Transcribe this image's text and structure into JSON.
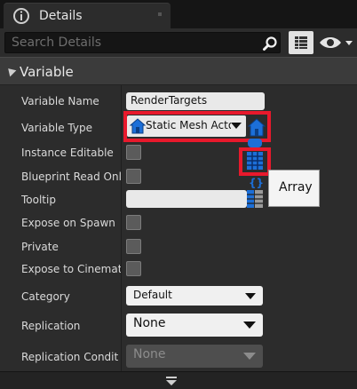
{
  "tab": {
    "title": "Details",
    "icon": "info-icon"
  },
  "search": {
    "placeholder": "Search Details"
  },
  "toolbar": {
    "view_options_icon": "grid-icon",
    "visibility_icon": "eye-icon"
  },
  "category": {
    "label": "Variable",
    "expanded": true
  },
  "properties": {
    "variable_name": {
      "label": "Variable Name",
      "value": "RenderTargets"
    },
    "variable_type": {
      "label": "Variable Type",
      "value": "Static Mesh Acto",
      "icon": "actor-icon"
    },
    "instance_editable": {
      "label": "Instance Editable"
    },
    "blueprint_read_only": {
      "label": "Blueprint Read Only"
    },
    "tooltip": {
      "label": "Tooltip",
      "value": ""
    },
    "expose_on_spawn": {
      "label": "Expose on Spawn"
    },
    "private": {
      "label": "Private"
    },
    "expose_to_cinematics": {
      "label": "Expose to Cinemati"
    },
    "category": {
      "label": "Category",
      "value": "Default"
    },
    "replication": {
      "label": "Replication",
      "value": "None"
    },
    "replication_condition": {
      "label": "Replication Conditio",
      "value": "None"
    }
  },
  "container_menu": {
    "options": [
      "single-icon",
      "array-icon",
      "set-icon",
      "map-icon"
    ],
    "hover_tooltip": "Array"
  },
  "colors": {
    "highlight": "#e8192c",
    "accent_blue": "#1c6fd8"
  }
}
